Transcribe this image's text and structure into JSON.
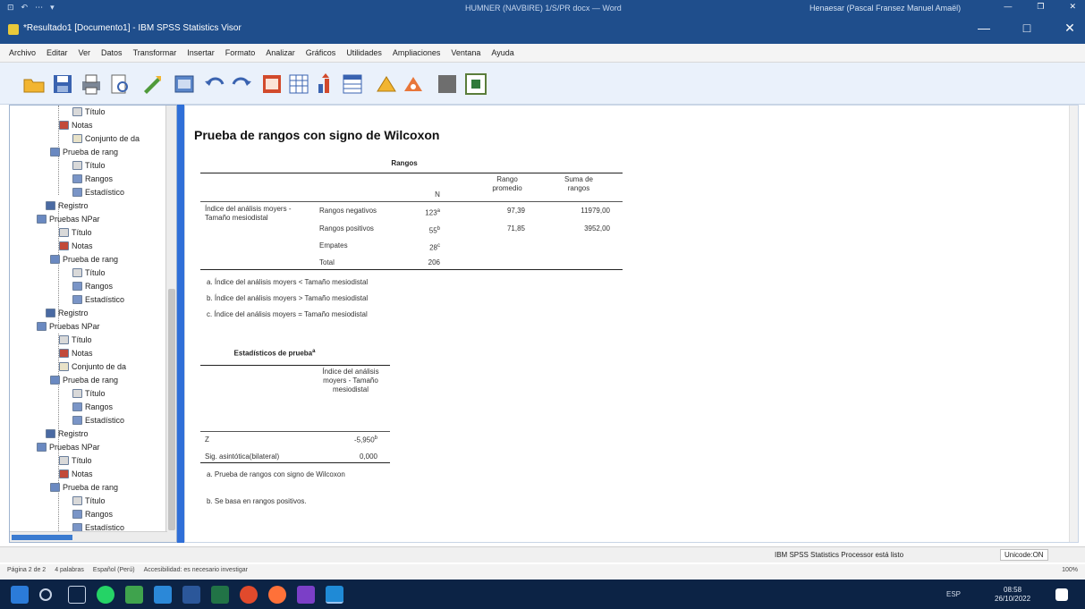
{
  "word_strip": {
    "left_items": [
      "⊡",
      "↶",
      "⋯",
      "▾"
    ],
    "doc_title": "HUMNER (NAVBIRE) 1/S/PR docx — Word",
    "user": "Henaesar (Pascal Fransez Manuel Amaël)",
    "controls": [
      "—",
      "❐",
      "✕"
    ]
  },
  "spss_window": {
    "title": "*Resultado1 [Documento1] - IBM SPSS Statistics Visor",
    "controls": {
      "minimize": "—",
      "maximize": "□",
      "close": "✕"
    }
  },
  "menu": [
    "Archivo",
    "Editar",
    "Ver",
    "Datos",
    "Transformar",
    "Insertar",
    "Formato",
    "Analizar",
    "Gráficos",
    "Utilidades",
    "Ampliaciones",
    "Ventana",
    "Ayuda"
  ],
  "toolbar_icons": [
    "open-icon",
    "save-icon",
    "print-icon",
    "print-preview-icon",
    "export-icon",
    "recall-dialog-icon",
    "undo-icon",
    "redo-icon",
    "goto-data-icon",
    "goto-case-icon",
    "goto-variable-icon",
    "variables-icon",
    "show-all-icon",
    "insert-output-icon",
    "delete-icon",
    "designate-window-icon"
  ],
  "outline": {
    "nodes": [
      {
        "label": "Título",
        "icon": "title"
      },
      {
        "label": "Notas",
        "icon": "note"
      },
      {
        "label": "Conjunto de da",
        "icon": "data"
      },
      {
        "label": "Prueba de rang",
        "icon": "book"
      },
      {
        "label": "Título",
        "icon": "title"
      },
      {
        "label": "Rangos",
        "icon": "table"
      },
      {
        "label": "Estadístico",
        "icon": "table"
      },
      {
        "label": "Registro",
        "icon": "log"
      },
      {
        "label": "Pruebas NPar",
        "icon": "book"
      },
      {
        "label": "Título",
        "icon": "title"
      },
      {
        "label": "Notas",
        "icon": "note"
      },
      {
        "label": "Prueba de rang",
        "icon": "book"
      },
      {
        "label": "Título",
        "icon": "title"
      },
      {
        "label": "Rangos",
        "icon": "table"
      },
      {
        "label": "Estadístico",
        "icon": "table"
      },
      {
        "label": "Registro",
        "icon": "log"
      },
      {
        "label": "Pruebas NPar",
        "icon": "book"
      },
      {
        "label": "Título",
        "icon": "title"
      },
      {
        "label": "Notas",
        "icon": "note"
      },
      {
        "label": "Conjunto de da",
        "icon": "data"
      },
      {
        "label": "Prueba de rang",
        "icon": "book"
      },
      {
        "label": "Título",
        "icon": "title"
      },
      {
        "label": "Rangos",
        "icon": "table"
      },
      {
        "label": "Estadístico",
        "icon": "table"
      },
      {
        "label": "Registro",
        "icon": "log"
      },
      {
        "label": "Pruebas NPar",
        "icon": "book"
      },
      {
        "label": "Título",
        "icon": "title"
      },
      {
        "label": "Notas",
        "icon": "note"
      },
      {
        "label": "Prueba de rang",
        "icon": "book"
      },
      {
        "label": "Título",
        "icon": "title"
      },
      {
        "label": "Rangos",
        "icon": "table"
      },
      {
        "label": "Estadístico",
        "icon": "table"
      }
    ]
  },
  "output": {
    "title": "Prueba de rangos con signo de Wilcoxon",
    "ranks_table": {
      "caption": "Rangos",
      "headers": {
        "n": "N",
        "mean": "Rango promedio",
        "sum": "Suma de rangos"
      },
      "variable": "Índice del análisis moyers - Tamaño mesiodistal",
      "rows": [
        {
          "label": "Rangos negativos",
          "n": "123",
          "sup": "a",
          "mean": "97,39",
          "sum": "11979,00"
        },
        {
          "label": "Rangos positivos",
          "n": "55",
          "sup": "b",
          "mean": "71,85",
          "sum": "3952,00"
        },
        {
          "label": "Empates",
          "n": "28",
          "sup": "c",
          "mean": "",
          "sum": ""
        },
        {
          "label": "Total",
          "n": "206",
          "sup": "",
          "mean": "",
          "sum": ""
        }
      ],
      "footnotes": [
        "a. Índice del análisis moyers < Tamaño mesiodistal",
        "b. Índice del análisis moyers > Tamaño mesiodistal",
        "c. Índice del análisis moyers = Tamaño mesiodistal"
      ]
    },
    "stats_table": {
      "caption": "Estadísticos de prueba",
      "caption_sup": "a",
      "col_header": "Índice del análisis moyers - Tamaño mesiodistal",
      "rows": [
        {
          "label": "Z",
          "value": "-5,950",
          "sup": "b"
        },
        {
          "label": "Sig. asintótica(bilateral)",
          "value": "0,000",
          "sup": ""
        }
      ],
      "footnotes": [
        "a. Prueba de rangos con signo de Wilcoxon",
        "b. Se basa en rangos positivos."
      ]
    }
  },
  "status": {
    "processor": "IBM SPSS Statistics Processor está listo",
    "encoding": "Unicode:ON"
  },
  "word_status": {
    "left": [
      "Página 2 de 2",
      "4 palabras",
      "Español (Perú)",
      "Accesibilidad: es necesario investigar"
    ],
    "zoom": "100%"
  },
  "taskbar": {
    "tray_text": "ESP",
    "time": "08:58",
    "date": "26/10/2022"
  }
}
